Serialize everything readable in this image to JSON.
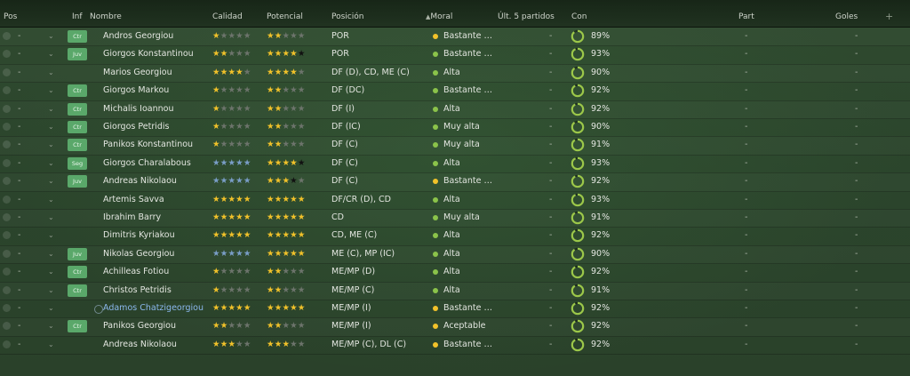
{
  "header": {
    "pos": "Pos",
    "inf": "Inf",
    "nombre": "Nombre",
    "calidad": "Calidad",
    "potencial": "Potencial",
    "posicion": "Posición",
    "moral": "Moral",
    "sort_icon": "▲",
    "ultimos": "Últ. 5 partidos",
    "con": "Con",
    "part": "Part",
    "goles": "Goles",
    "add": "+"
  },
  "colors": {
    "gold": "#f2c22a",
    "morale_green": "#8bc34a",
    "morale_yellow": "#f2c22a",
    "badge_green": "#5aa86a",
    "highlight_name": "#8bb8ee"
  },
  "players": [
    {
      "pos": "-",
      "badge": "Ctr",
      "name": "Andros Georgiou",
      "quality": 1,
      "potential": 1.5,
      "potential_black": 0,
      "quality_blue": 0,
      "position": "POR",
      "morale": "Bastante b...",
      "morale_color": "yellow",
      "last5": "-",
      "condition": "89%",
      "cond_value": 0.89,
      "part": "-",
      "goals": "-"
    },
    {
      "pos": "-",
      "badge": "Juv",
      "name": "Giorgos Konstantinou",
      "quality": 2,
      "potential": 4,
      "potential_black": 1,
      "quality_blue": 0,
      "position": "POR",
      "morale": "Bastante alta",
      "morale_color": "green",
      "last5": "-",
      "condition": "93%",
      "cond_value": 0.93,
      "part": "-",
      "goals": "-"
    },
    {
      "pos": "-",
      "badge": "",
      "name": "Marios Georgiou",
      "quality": 3.5,
      "potential": 3.5,
      "potential_black": 0,
      "quality_blue": 0,
      "position": "DF (D), CD, ME (C)",
      "morale": "Alta",
      "morale_color": "green",
      "last5": "-",
      "condition": "90%",
      "cond_value": 0.9,
      "part": "-",
      "goals": "-"
    },
    {
      "pos": "-",
      "badge": "Ctr",
      "name": "Giorgos Markou",
      "quality": 1,
      "potential": 2,
      "potential_black": 0,
      "quality_blue": 0,
      "position": "DF (DC)",
      "morale": "Bastante alta",
      "morale_color": "green",
      "last5": "-",
      "condition": "92%",
      "cond_value": 0.92,
      "part": "-",
      "goals": "-"
    },
    {
      "pos": "-",
      "badge": "Ctr",
      "name": "Michalis Ioannou",
      "quality": 1,
      "potential": 1.5,
      "potential_black": 0,
      "quality_blue": 0,
      "position": "DF (I)",
      "morale": "Alta",
      "morale_color": "green",
      "last5": "-",
      "condition": "92%",
      "cond_value": 0.92,
      "part": "-",
      "goals": "-"
    },
    {
      "pos": "-",
      "badge": "Ctr",
      "name": "Giorgos Petridis",
      "quality": 1,
      "potential": 1.5,
      "potential_black": 0,
      "quality_blue": 0,
      "position": "DF (IC)",
      "morale": "Muy alta",
      "morale_color": "green",
      "last5": "-",
      "condition": "90%",
      "cond_value": 0.9,
      "part": "-",
      "goals": "-"
    },
    {
      "pos": "-",
      "badge": "Ctr",
      "name": "Panikos Konstantinou",
      "quality": 1,
      "potential": 2,
      "potential_black": 0,
      "quality_blue": 0,
      "position": "DF (C)",
      "morale": "Muy alta",
      "morale_color": "green",
      "last5": "-",
      "condition": "91%",
      "cond_value": 0.91,
      "part": "-",
      "goals": "-"
    },
    {
      "pos": "-",
      "badge": "Seg",
      "name": "Giorgos Charalabous",
      "quality": 0,
      "potential": 4,
      "potential_black": 1,
      "quality_blue": 5,
      "position": "DF (C)",
      "morale": "Alta",
      "morale_color": "green",
      "last5": "-",
      "condition": "93%",
      "cond_value": 0.93,
      "part": "-",
      "goals": "-"
    },
    {
      "pos": "-",
      "badge": "Juv",
      "name": "Andreas Nikolaou",
      "quality": 0,
      "potential": 3,
      "potential_black": 1,
      "quality_blue": 5,
      "position": "DF (C)",
      "morale": "Bastante b...",
      "morale_color": "yellow",
      "last5": "-",
      "condition": "92%",
      "cond_value": 0.92,
      "part": "-",
      "goals": "-"
    },
    {
      "pos": "-",
      "badge": "",
      "name": "Artemis Savva",
      "quality": 5,
      "potential": 5,
      "potential_black": 0,
      "quality_blue": 0,
      "position": "DF/CR (D), CD",
      "morale": "Alta",
      "morale_color": "green",
      "last5": "-",
      "condition": "93%",
      "cond_value": 0.93,
      "part": "-",
      "goals": "-"
    },
    {
      "pos": "-",
      "badge": "",
      "name": "Ibrahim Barry",
      "quality": 5,
      "potential": 5,
      "potential_black": 0,
      "quality_blue": 0,
      "position": "CD",
      "morale": "Muy alta",
      "morale_color": "green",
      "last5": "-",
      "condition": "91%",
      "cond_value": 0.91,
      "part": "-",
      "goals": "-"
    },
    {
      "pos": "-",
      "badge": "",
      "name": "Dimitris Kyriakou",
      "quality": 5,
      "potential": 5,
      "potential_black": 0,
      "quality_blue": 0,
      "position": "CD, ME (C)",
      "morale": "Alta",
      "morale_color": "green",
      "last5": "-",
      "condition": "92%",
      "cond_value": 0.92,
      "part": "-",
      "goals": "-"
    },
    {
      "pos": "-",
      "badge": "Juv",
      "name": "Nikolas Georgiou",
      "quality": 0,
      "potential": 4.5,
      "potential_black": 0.5,
      "quality_blue": 5,
      "position": "ME (C), MP (IC)",
      "morale": "Alta",
      "morale_color": "green",
      "last5": "-",
      "condition": "90%",
      "cond_value": 0.9,
      "part": "-",
      "goals": "-"
    },
    {
      "pos": "-",
      "badge": "Ctr",
      "name": "Achilleas Fotiou",
      "quality": 1,
      "potential": 1.5,
      "potential_black": 0,
      "quality_blue": 0,
      "position": "ME/MP (D)",
      "morale": "Alta",
      "morale_color": "green",
      "last5": "-",
      "condition": "92%",
      "cond_value": 0.92,
      "part": "-",
      "goals": "-"
    },
    {
      "pos": "-",
      "badge": "Ctr",
      "name": "Christos Petridis",
      "quality": 1,
      "potential": 2,
      "potential_black": 0,
      "quality_blue": 0,
      "position": "ME/MP (C)",
      "morale": "Alta",
      "morale_color": "green",
      "last5": "-",
      "condition": "91%",
      "cond_value": 0.91,
      "part": "-",
      "goals": "-"
    },
    {
      "pos": "-",
      "badge": "",
      "name": "Adamos Chatzigeorgiou",
      "highlight": true,
      "quality": 5,
      "potential": 5,
      "potential_black": 0,
      "quality_blue": 0,
      "position": "ME/MP (I)",
      "morale": "Bastante b...",
      "morale_color": "yellow",
      "last5": "-",
      "condition": "92%",
      "cond_value": 0.92,
      "part": "-",
      "goals": "-"
    },
    {
      "pos": "-",
      "badge": "Ctr",
      "name": "Panikos Georgiou",
      "quality": 1.5,
      "potential": 1.5,
      "potential_black": 0,
      "quality_blue": 0,
      "position": "ME/MP (I)",
      "morale": "Aceptable",
      "morale_color": "yellow",
      "last5": "-",
      "condition": "92%",
      "cond_value": 0.92,
      "part": "-",
      "goals": "-"
    },
    {
      "pos": "-",
      "badge": "",
      "name": "Andreas Nikolaou",
      "quality": 2.5,
      "potential": 2.5,
      "potential_black": 0,
      "quality_blue": 0,
      "position": "ME/MP (C), DL (C)",
      "morale": "Bastante b...",
      "morale_color": "yellow",
      "last5": "-",
      "condition": "92%",
      "cond_value": 0.92,
      "part": "-",
      "goals": "-"
    }
  ]
}
